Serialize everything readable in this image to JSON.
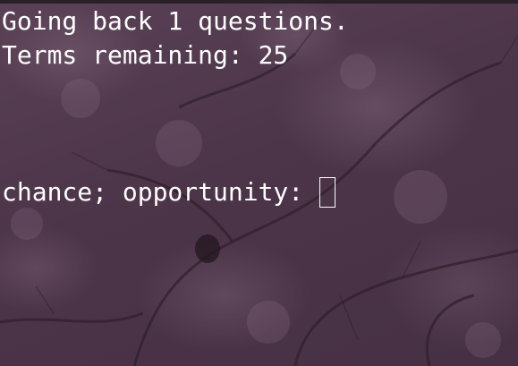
{
  "terminal": {
    "lines": [
      "Going back 1 questions.",
      "Terms remaining: 25"
    ],
    "prompt": "chance; opportunity:",
    "input_value": ""
  }
}
